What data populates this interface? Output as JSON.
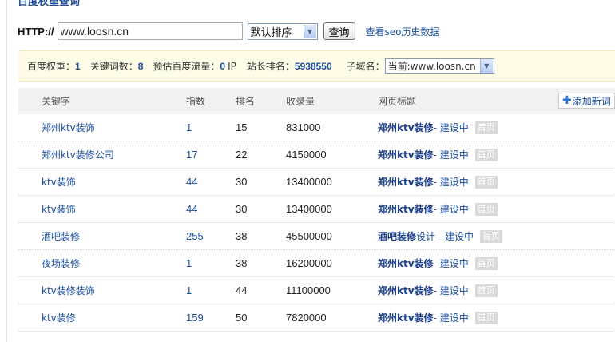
{
  "page": {
    "heading": "百度权重查询"
  },
  "query": {
    "protocol_label": "HTTP://",
    "url_value": "www.loosn.cn",
    "sort_selected": "默认排序",
    "submit_label": "查询",
    "history_link": "查看seo历史数据"
  },
  "stats": {
    "weight_label": "百度权重：",
    "weight_value": "1",
    "keywords_label": "关键词数：",
    "keywords_value": "8",
    "traffic_label": "预估百度流量：",
    "traffic_value": "0",
    "traffic_unit": "IP",
    "rank_label": "站长排名：",
    "rank_value": "5938550",
    "subdomain_label": "子域名：",
    "subdomain_selected": "当前:www.loosn.cn"
  },
  "table": {
    "headers": {
      "keyword": "关键字",
      "index": "指数",
      "rank": "排名",
      "indexed": "收录量",
      "title": "网页标题"
    },
    "add_keyword_label": "添加新词",
    "rows": [
      {
        "keyword": "郑州ktv装饰",
        "index": "1",
        "rank": "15",
        "indexed": "831000",
        "title_strong": "郑州ktv装修",
        "title_rest": " - 建设中",
        "badge": "首页"
      },
      {
        "keyword": "郑州ktv装修公司",
        "index": "17",
        "rank": "22",
        "indexed": "4150000",
        "title_strong": "郑州ktv装修",
        "title_rest": " - 建设中",
        "badge": "首页"
      },
      {
        "keyword": "ktv装饰",
        "index": "44",
        "rank": "30",
        "indexed": "13400000",
        "title_strong": "郑州ktv装修",
        "title_rest": " - 建设中",
        "badge": "首页"
      },
      {
        "keyword": "ktv装饰",
        "index": "44",
        "rank": "30",
        "indexed": "13400000",
        "title_strong": "郑州ktv装修",
        "title_rest": " - 建设中",
        "badge": "首页"
      },
      {
        "keyword": "酒吧装修",
        "index": "255",
        "rank": "38",
        "indexed": "45500000",
        "title_strong": "酒吧装修",
        "title_rest": "设计 - 建设中",
        "badge": "首页"
      },
      {
        "keyword": "夜场装修",
        "index": "1",
        "rank": "38",
        "indexed": "16200000",
        "title_strong": "郑州ktv装修",
        "title_rest": " - 建设中",
        "badge": "首页"
      },
      {
        "keyword": "ktv装修装饰",
        "index": "1",
        "rank": "44",
        "indexed": "11100000",
        "title_strong": "郑州ktv装修",
        "title_rest": " - 建设中",
        "badge": "首页"
      },
      {
        "keyword": "ktv装修",
        "index": "159",
        "rank": "50",
        "indexed": "7820000",
        "title_strong": "郑州ktv装修",
        "title_rest": " - 建设中",
        "badge": "首页"
      }
    ]
  },
  "icons": {
    "dropdown": "chevron-down-icon",
    "add": "plus-icon"
  }
}
